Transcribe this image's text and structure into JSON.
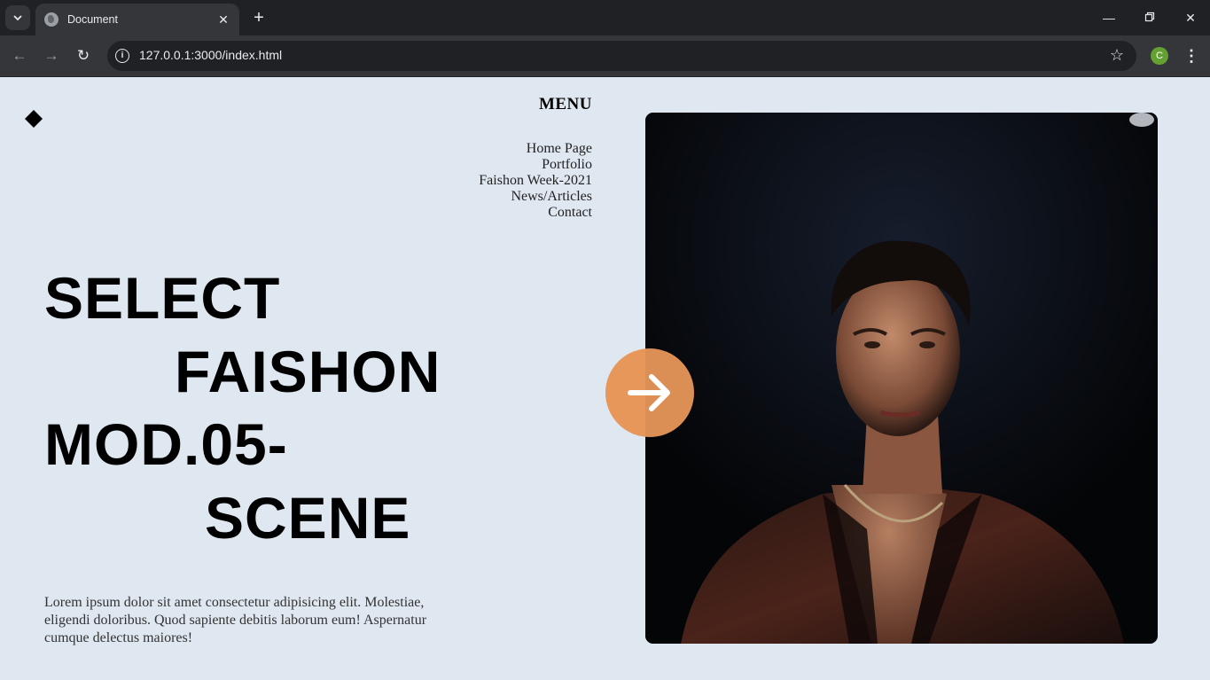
{
  "browser": {
    "tab_title": "Document",
    "url": "127.0.0.1:3000/index.html",
    "profile_initial": "C"
  },
  "nav": {
    "menu_title": "MENU",
    "items": [
      {
        "label": "Home Page"
      },
      {
        "label": "Portfolio"
      },
      {
        "label": "Faishon Week-2021"
      },
      {
        "label": "News/Articles"
      },
      {
        "label": "Contact"
      }
    ]
  },
  "hero": {
    "line1": "SELECT",
    "line2": "FAISHON",
    "line3": "MOD.05-",
    "line4": "SCENE",
    "description": "Lorem ipsum dolor sit amet consectetur adipisicing elit. Molestiae, eligendi doloribus. Quod sapiente debitis laborum eum! Aspernatur cumque delectus maiores!"
  },
  "colors": {
    "page_bg": "#dfe7f0",
    "accent": "#e8975a",
    "text": "#000000"
  },
  "icons": {
    "logo": "diamond-icon",
    "arrow_button": "arrow-right-icon"
  }
}
